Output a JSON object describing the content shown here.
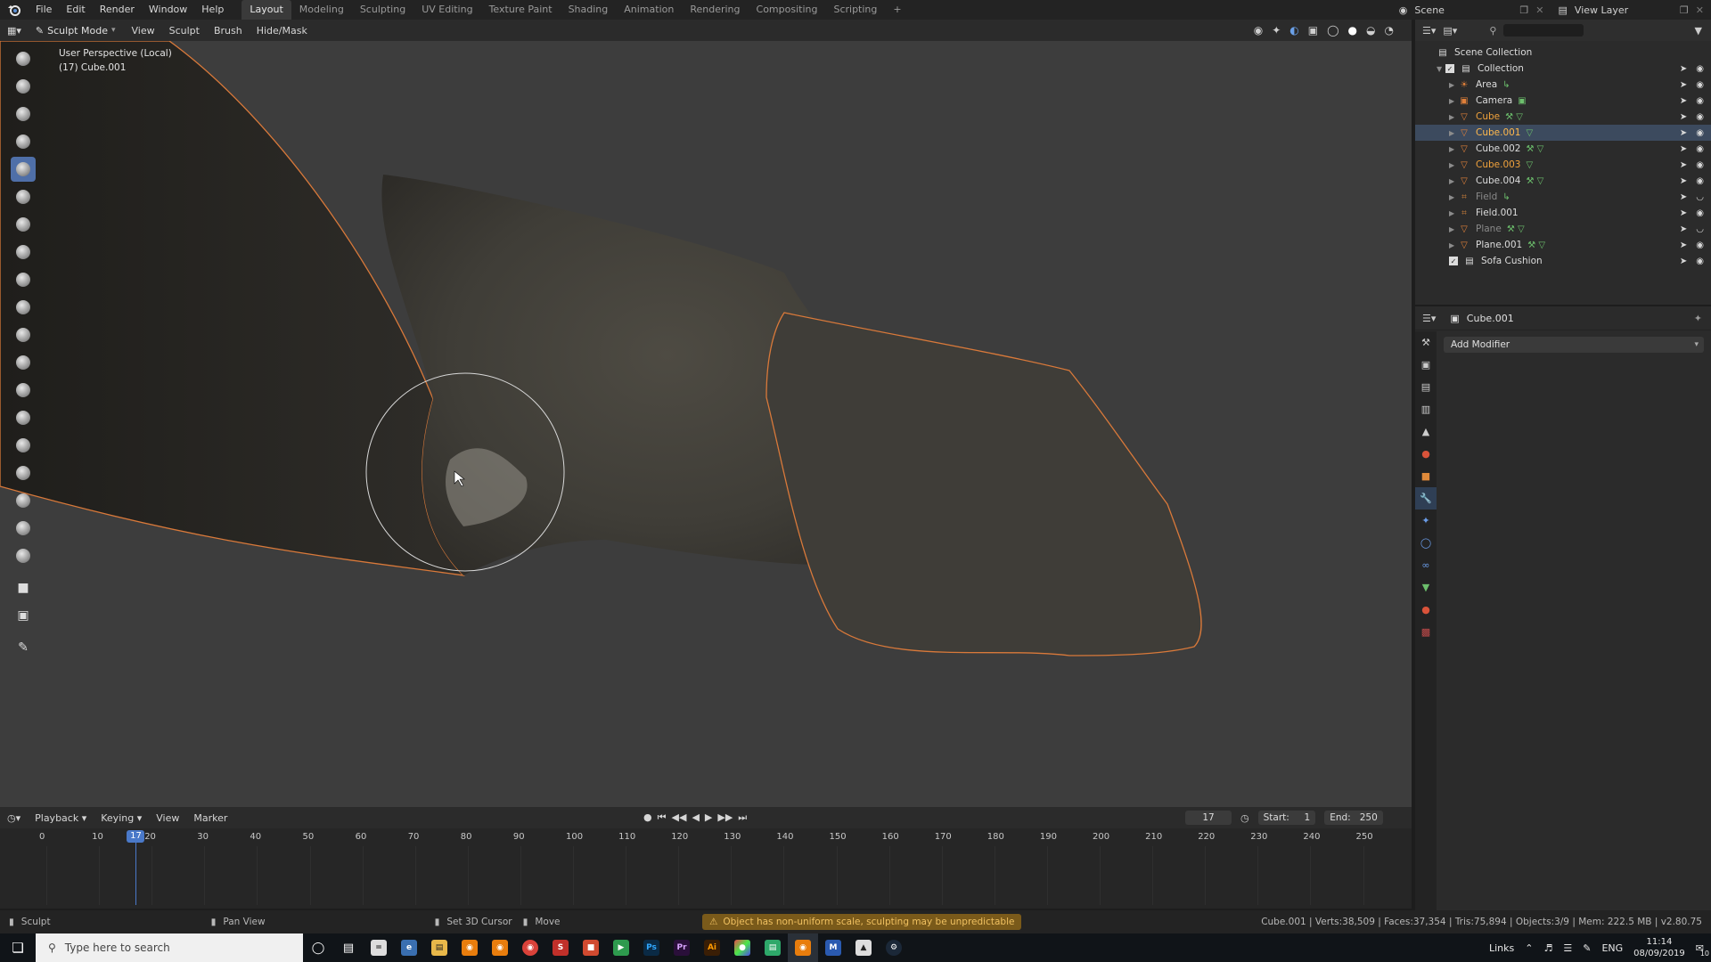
{
  "topbar": {
    "menus": [
      "File",
      "Edit",
      "Render",
      "Window",
      "Help"
    ],
    "workspaces": [
      "Layout",
      "Modeling",
      "Sculpting",
      "UV Editing",
      "Texture Paint",
      "Shading",
      "Animation",
      "Rendering",
      "Compositing",
      "Scripting",
      "+"
    ],
    "active_workspace": "Layout",
    "scene": "Scene",
    "view_layer": "View Layer"
  },
  "viewport_header": {
    "mode": "Sculpt Mode",
    "menus": [
      "View",
      "Sculpt",
      "Brush",
      "Hide/Mask"
    ]
  },
  "viewport": {
    "perspective_label": "User Perspective (Local)",
    "object_label": "(17) Cube.001"
  },
  "outliner": {
    "root": "Scene Collection",
    "collection": "Collection",
    "items": [
      {
        "name": "Area",
        "color": "#dcdcdc",
        "icon": "light-icon",
        "extra": "light-data-icon"
      },
      {
        "name": "Camera",
        "color": "#dcdcdc",
        "icon": "camera-icon",
        "extra": "camera-data-icon"
      },
      {
        "name": "Cube",
        "color": "#f0a23c",
        "icon": "mesh-icon",
        "extra": "modifier-mesh-icons"
      },
      {
        "name": "Cube.001",
        "color": "#ffb84d",
        "icon": "mesh-icon",
        "extra": "mesh-data-icon"
      },
      {
        "name": "Cube.002",
        "color": "#dcdcdc",
        "icon": "mesh-icon",
        "extra": "modifier-mesh-icons"
      },
      {
        "name": "Cube.003",
        "color": "#f0a23c",
        "icon": "mesh-icon",
        "extra": "mesh-data-icon"
      },
      {
        "name": "Cube.004",
        "color": "#dcdcdc",
        "icon": "mesh-icon",
        "extra": "modifier-mesh-icons"
      },
      {
        "name": "Field",
        "color": "#8a8a8a",
        "icon": "field-icon",
        "extra": "field-data-icon"
      },
      {
        "name": "Field.001",
        "color": "#dcdcdc",
        "icon": "field-icon",
        "extra": ""
      },
      {
        "name": "Plane",
        "color": "#8a8a8a",
        "icon": "mesh-icon",
        "extra": "modifier-mesh-icons"
      },
      {
        "name": "Plane.001",
        "color": "#dcdcdc",
        "icon": "mesh-icon",
        "extra": "modifier-mesh-icons"
      }
    ],
    "extra_collection": "Sofa Cushion"
  },
  "properties": {
    "object_name": "Cube.001",
    "add_modifier": "Add Modifier"
  },
  "timeline": {
    "menus": [
      "Playback",
      "Keying",
      "View",
      "Marker"
    ],
    "current_frame": "17",
    "start_label": "Start:",
    "start": "1",
    "end_label": "End:",
    "end": "250",
    "ticks": [
      "0",
      "10",
      "20",
      "30",
      "40",
      "50",
      "60",
      "70",
      "80",
      "90",
      "100",
      "110",
      "120",
      "130",
      "140",
      "150",
      "160",
      "170",
      "180",
      "190",
      "200",
      "210",
      "220",
      "230",
      "240",
      "250"
    ]
  },
  "statusbar": {
    "left": "Sculpt",
    "pan": "Pan View",
    "cursor": "Set 3D Cursor",
    "move": "Move",
    "warning": "Object has non-uniform scale, sculpting may be unpredictable",
    "stats": "Cube.001 | Verts:38,509 | Faces:37,354 | Tris:75,894 | Objects:3/9 | Mem: 222.5 MB | v2.80.75"
  },
  "taskbar": {
    "search_placeholder": "Type here to search",
    "links": "Links",
    "language": "ENG",
    "time": "11:14",
    "date": "08/09/2019",
    "notification_count": "10"
  },
  "colors": {
    "accent": "#4a79c9",
    "selection_outline": "#e0803a",
    "warning": "#f0c060"
  }
}
